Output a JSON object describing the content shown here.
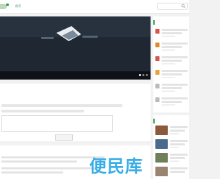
{
  "header": {
    "nav": [
      {
        "label": "首页",
        "active": true
      },
      {
        "label": "",
        "active": false
      },
      {
        "label": "",
        "active": false
      },
      {
        "label": "",
        "active": false
      }
    ],
    "search_placeholder": "",
    "search_icon": "search-icon"
  },
  "banner": {
    "title": "",
    "caption": "",
    "slides": 3,
    "active_slide": 1
  },
  "form_panel": {
    "title": "",
    "submit_label": ""
  },
  "article_panel": {
    "title": ""
  },
  "sidebar": {
    "hot_title": "",
    "hot_badge_colors": [
      "#d9534f",
      "#e08a2c",
      "#d9534f",
      "#e8a33a",
      "#bbbbbb",
      "#bbbbbb"
    ],
    "rec_title": ""
  },
  "watermark": {
    "text": "便民库"
  },
  "colors": {
    "accent": "#2f9e5c",
    "banner_bg": "#1f2733",
    "watermark": "#29a8e6"
  }
}
